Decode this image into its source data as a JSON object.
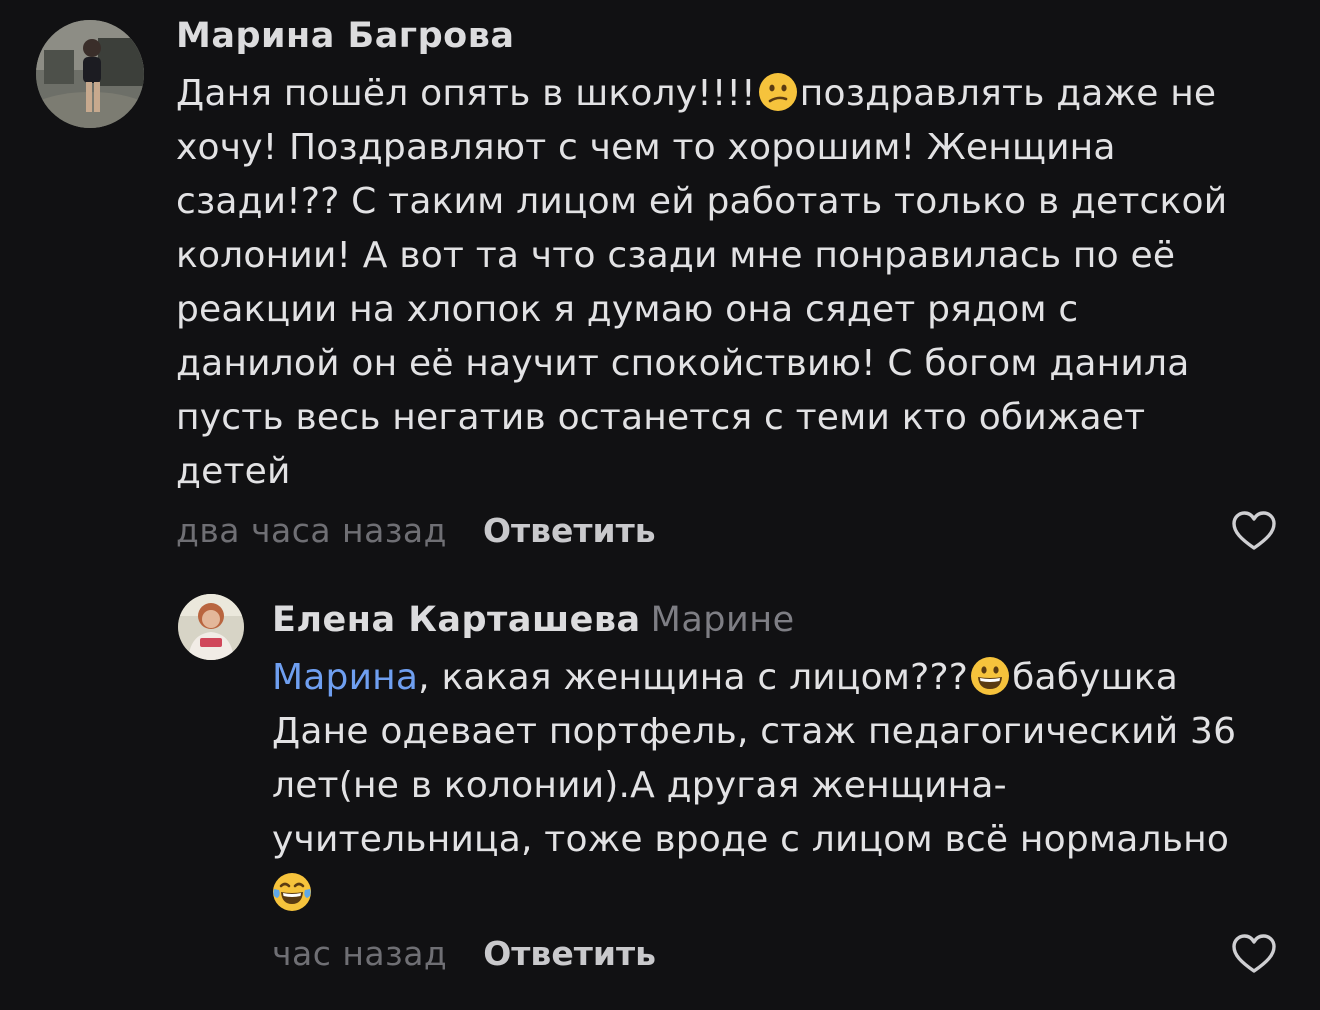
{
  "comments": [
    {
      "author": "Марина Багрова",
      "lines": [
        {
          "text": "Даня пошёл  опять в школу!!!!",
          "emoji_after": "confused-face",
          "text2": "поздравлять даже не"
        },
        {
          "text": "хочу! Поздравляют с чем то хорошим! Женщина"
        },
        {
          "text": "сзади!?? С таким лицом ей работать только в детской"
        },
        {
          "text": "колонии! А вот та что сзади мне понравилась по её"
        },
        {
          "text": "реакции на хлопок я думаю она сядет рядом с"
        },
        {
          "text": "данилой он её научит спокойствию! С богом данила"
        },
        {
          "text": "пусть весь негатив останется с теми кто обижает"
        },
        {
          "text": "детей"
        }
      ],
      "time": "два часа назад",
      "reply_label": "Ответить",
      "like_icon": "heart-outline-icon"
    },
    {
      "author": "Елена Карташева",
      "reply_to": "Марине",
      "mention": "Марина",
      "lines": [
        {
          "text": ", какая женщина с лицом???",
          "emoji_after": "grinning-face",
          "text2": "бабушка"
        },
        {
          "text": "Дане одевает портфель, стаж педагогический 36"
        },
        {
          "text": "лет(не в колонии).А другая женщина-"
        },
        {
          "text": "учительница, тоже вроде с лицом всё нормально"
        },
        {
          "emoji_only": "face-with-tears-of-joy"
        }
      ],
      "time": "час назад",
      "reply_label": "Ответить",
      "like_icon": "heart-outline-icon"
    }
  ],
  "colors": {
    "background": "#111113",
    "text": "#e2e2e4",
    "muted": "#6f6f74",
    "mention": "#6f9ff0",
    "emoji": "#f6c33c"
  }
}
